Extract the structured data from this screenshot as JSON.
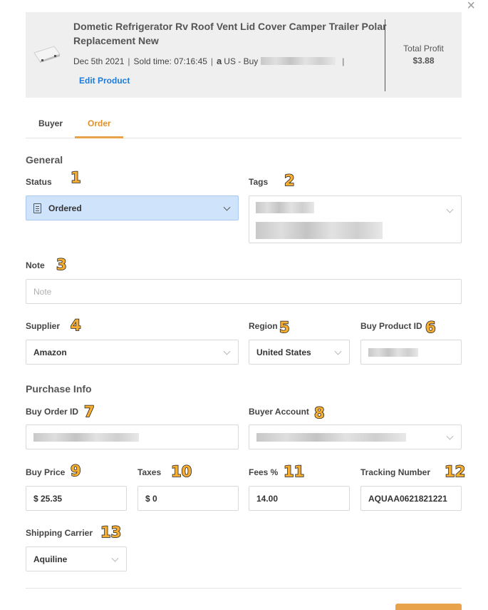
{
  "product": {
    "title": "Dometic Refrigerator Rv Roof Vent Lid Cover Camper Trailer Polar Replacement New",
    "date": "Dec 5th 2021",
    "sold_time": "Sold time: 07:16:45",
    "marketplace_icon": "amazon-a-icon",
    "marketplace": "US - Buy",
    "edit_label": "Edit Product",
    "total_profit_label": "Total Profit",
    "total_profit_value": "$3.88"
  },
  "tabs": [
    {
      "label": "Buyer",
      "active": false
    },
    {
      "label": "Order",
      "active": true
    }
  ],
  "general": {
    "heading": "General",
    "status_label": "Status",
    "status_value": "Ordered",
    "tags_label": "Tags",
    "note_label": "Note",
    "note_placeholder": "Note",
    "supplier_label": "Supplier",
    "supplier_value": "Amazon",
    "region_label": "Region",
    "region_value": "United States",
    "buy_product_id_label": "Buy Product ID"
  },
  "purchase": {
    "heading": "Purchase Info",
    "buy_order_id_label": "Buy Order ID",
    "buyer_account_label": "Buyer Account",
    "buy_price_label": "Buy Price",
    "buy_price_value": "$ 25.35",
    "taxes_label": "Taxes",
    "taxes_value": "$ 0",
    "fees_label": "Fees %",
    "fees_value": "14.00",
    "tracking_label": "Tracking Number",
    "tracking_value": "AQUAA0621821221",
    "carrier_label": "Shipping Carrier",
    "carrier_value": "Aquiline"
  },
  "markers": [
    "1",
    "2",
    "3",
    "4",
    "5",
    "6",
    "7",
    "8",
    "9",
    "10",
    "11",
    "12",
    "13"
  ],
  "colors": {
    "accent": "#e8a24a",
    "link": "#1e7bd6",
    "status_bg": "#cfe3fb",
    "marker": "#f5ad32"
  }
}
